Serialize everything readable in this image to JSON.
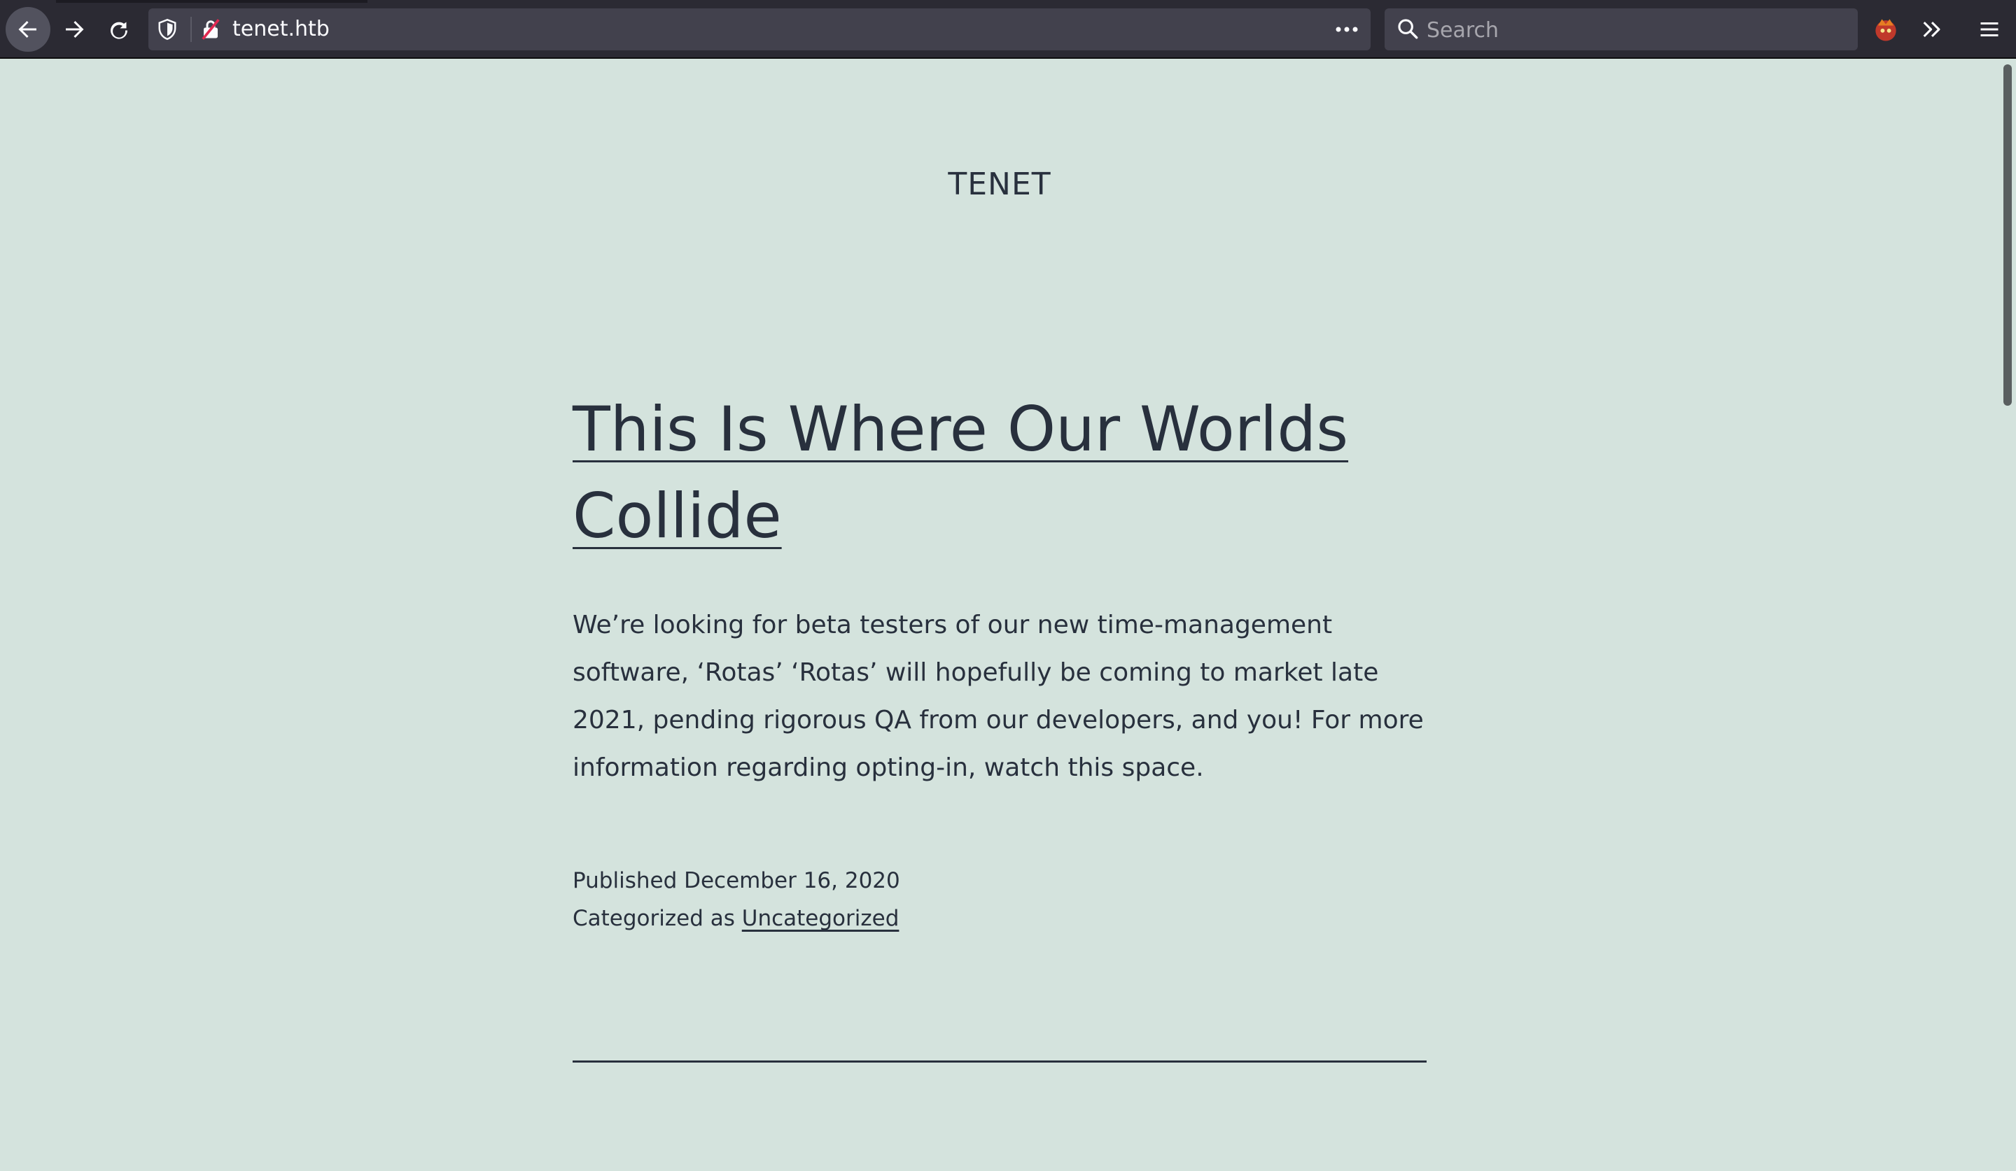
{
  "browser": {
    "url": "tenet.htb",
    "search_placeholder": "Search",
    "icons": {
      "back": "arrow-left-icon",
      "forward": "arrow-right-icon",
      "reload": "reload-icon",
      "tracking_protection": "shield-icon",
      "insecure": "insecure-lock-icon",
      "page_actions": "more-dots-icon",
      "search": "search-icon",
      "extension": "extension-icon",
      "overflow": "chevron-double-right-icon",
      "menu": "hamburger-menu-icon"
    }
  },
  "page": {
    "site_title": "TENET",
    "post": {
      "title": "This Is Where Our Worlds Collide",
      "content": "We’re looking for beta testers of our new time-management software, ‘Rotas’ ‘Rotas’ will hopefully be coming to market late 2021, pending rigorous QA from our developers, and you! For more information regarding opting-in, watch this space.",
      "published": "Published December 16, 2020",
      "categorized_label": "Categorized as ",
      "category": "Uncategorized"
    }
  },
  "colors": {
    "background": "#d4e3dd",
    "text": "#28303d",
    "toolbar": "#2b2a33",
    "field": "#42414d"
  }
}
